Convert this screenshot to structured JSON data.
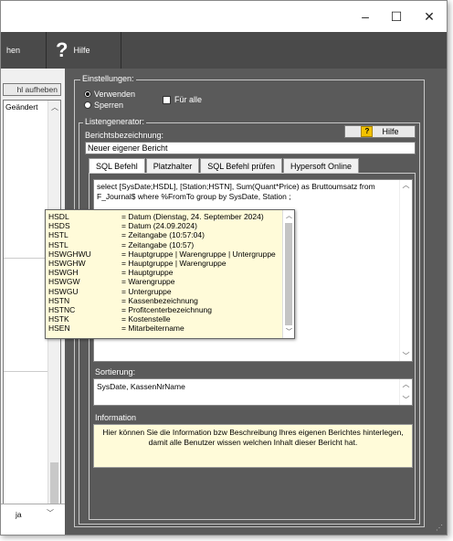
{
  "window": {
    "controls": {
      "minimize": "–",
      "maximize": "☐",
      "close": "✕"
    }
  },
  "toolbar": {
    "left_label": "hen",
    "help_glyph": "?",
    "help_label": "Hilfe"
  },
  "left_panel": {
    "button_label": "hl aufheben",
    "list_items": [
      "Geändert"
    ],
    "bottom_value": "ja"
  },
  "settings": {
    "group_label": "Einstellungen:",
    "radio_use": "Verwenden",
    "radio_lock": "Sperren",
    "checkbox_all": "Für alle"
  },
  "generator": {
    "group_label": "Listengenerator:",
    "name_label": "Berichtsbezeichnung:",
    "name_value": "Neuer eigener Bericht",
    "help_button": "Hilfe",
    "tabs": [
      "SQL Befehl",
      "Platzhalter",
      "SQL Befehl prüfen",
      "Hypersoft Online"
    ],
    "sql_text": "select [SysDate;HSDL], [Station;HSTN], Sum(Quant*Price) as Bruttoumsatz from F_Journal$ where %FromTo group by SysDate, Station ;",
    "sort_label": "Sortierung:",
    "sort_value": "SysDate, KassenNrName",
    "info_label": "Information",
    "info_line1": "Hier können Sie die Information bzw Beschreibung Ihres eigenen Berichtes hinterlegen,",
    "info_line2": "damit alle Benutzer wissen welchen Inhalt dieser Bericht hat."
  },
  "placeholders": [
    {
      "key": "HSDL",
      "value": "= Datum  (Dienstag, 24. September 2024)"
    },
    {
      "key": "HSDS",
      "value": "= Datum  (24.09.2024)"
    },
    {
      "key": "HSTL",
      "value": "= Zeitangabe (10:57:04)"
    },
    {
      "key": "HSTL",
      "value": "= Zeitangabe (10:57)"
    },
    {
      "key": "HSWGHWU",
      "value": "= Hauptgruppe | Warengruppe | Untergruppe"
    },
    {
      "key": "HSWGHW",
      "value": "= Hauptgruppe | Warengruppe"
    },
    {
      "key": "HSWGH",
      "value": "= Hauptgruppe"
    },
    {
      "key": "HSWGW",
      "value": "= Warengruppe"
    },
    {
      "key": "HSWGU",
      "value": "= Untergruppe"
    },
    {
      "key": "HSTN",
      "value": "= Kassenbezeichnung"
    },
    {
      "key": "HSTNC",
      "value": "= Profitcenterbezeichnung"
    },
    {
      "key": "HSTK",
      "value": "= Kostenstelle"
    },
    {
      "key": "HSEN",
      "value": "= Mitarbeitername"
    }
  ]
}
